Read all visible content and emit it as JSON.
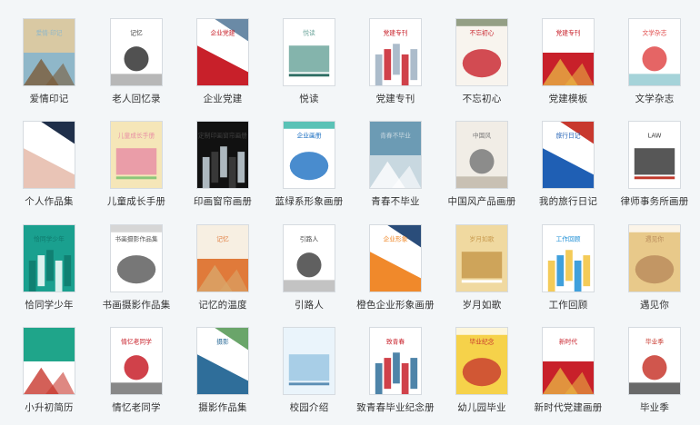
{
  "items": [
    {
      "label": "爱情印记",
      "cover_text": "爱情·印记",
      "colors": [
        "#d9c9a3",
        "#8fb7c9",
        "#7a5b3a"
      ],
      "icon": "couple-photo-icon"
    },
    {
      "label": "老人回忆录",
      "cover_text": "记忆",
      "colors": [
        "#ffffff",
        "#333333",
        "#999999"
      ],
      "icon": "ink-painting-icon"
    },
    {
      "label": "企业党建",
      "cover_text": "企业党建",
      "colors": [
        "#ffffff",
        "#c8202a",
        "#6a8aa6"
      ],
      "icon": "city-skyline-icon"
    },
    {
      "label": "悦读",
      "cover_text": "悦读",
      "colors": [
        "#ffffff",
        "#6fa79d",
        "#2f6e64"
      ],
      "icon": "chair-plant-icon"
    },
    {
      "label": "党建专刊",
      "cover_text": "党建专刊",
      "colors": [
        "#ffffff",
        "#c8202a",
        "#9db0c2"
      ],
      "icon": "flag-mountain-icon"
    },
    {
      "label": "不忘初心",
      "cover_text": "不忘初心",
      "colors": [
        "#f8f4ee",
        "#c8202a",
        "#7a8a6a"
      ],
      "icon": "landscape-icon"
    },
    {
      "label": "党建模板",
      "cover_text": "党建专刊",
      "colors": [
        "#ffffff",
        "#c8202a",
        "#e7b043"
      ],
      "icon": "tiananmen-icon"
    },
    {
      "label": "文学杂志",
      "cover_text": "文学杂志",
      "colors": [
        "#ffffff",
        "#e04a4a",
        "#7fc1c9"
      ],
      "icon": "red-leaves-icon"
    },
    {
      "label": "个人作品集",
      "cover_text": "",
      "colors": [
        "#ffffff",
        "#e9c4b6",
        "#1f2f4a"
      ],
      "icon": "triangle-portrait-icon"
    },
    {
      "label": "儿童成长手册",
      "cover_text": "儿童成长手册",
      "colors": [
        "#f5e6b8",
        "#e88fa4",
        "#8cc67a"
      ],
      "icon": "flowers-icon"
    },
    {
      "label": "印画窗帘画册",
      "cover_text": "定制印画窗帘画册",
      "colors": [
        "#111111",
        "#3f3f3f",
        "#c9d6de"
      ],
      "icon": "window-curtain-icon"
    },
    {
      "label": "蓝绿系形象画册",
      "cover_text": "企业画册",
      "colors": [
        "#ffffff",
        "#1b6fc2",
        "#2fb3a4"
      ],
      "icon": "blue-building-icon"
    },
    {
      "label": "青春不毕业",
      "cover_text": "青春不毕业",
      "colors": [
        "#6c9bb4",
        "#c8d8e0",
        "#ffffff"
      ],
      "icon": "graduation-icon"
    },
    {
      "label": "中国风产品画册",
      "cover_text": "中国风",
      "colors": [
        "#f1ede6",
        "#7a7a7a",
        "#b6ad9c"
      ],
      "icon": "round-window-icon"
    },
    {
      "label": "我的旅行日记",
      "cover_text": "旅行日记",
      "colors": [
        "#ffffff",
        "#1f5fb4",
        "#c8382e"
      ],
      "icon": "travel-photo-icon"
    },
    {
      "label": "律师事务所画册",
      "cover_text": "LAW",
      "colors": [
        "#ffffff",
        "#3a3a3a",
        "#c0392b"
      ],
      "icon": "law-sign-icon"
    },
    {
      "label": "恰同学少年",
      "cover_text": "恰同学少年",
      "colors": [
        "#1aa08f",
        "#ffffff",
        "#0f7a6d"
      ],
      "icon": "youth-title-icon"
    },
    {
      "label": "书画摄影作品集",
      "cover_text": "书画摄影作品集",
      "colors": [
        "#ffffff",
        "#555555",
        "#cccccc"
      ],
      "icon": "text-page-icon"
    },
    {
      "label": "记忆的温度",
      "cover_text": "记忆",
      "colors": [
        "#f7efe2",
        "#e07a3a",
        "#d9a66a"
      ],
      "icon": "autumn-leaves-icon"
    },
    {
      "label": "引路人",
      "cover_text": "引路人",
      "colors": [
        "#ffffff",
        "#444444",
        "#aaaaaa"
      ],
      "icon": "ink-mountain-icon"
    },
    {
      "label": "橙色企业形象画册",
      "cover_text": "企业形象",
      "colors": [
        "#ffffff",
        "#f0892b",
        "#2a4d7a"
      ],
      "icon": "orange-building-icon"
    },
    {
      "label": "岁月如歌",
      "cover_text": "岁月如歌",
      "colors": [
        "#f0d9a0",
        "#c89a4e",
        "#ffffff"
      ],
      "icon": "building-photo-icon"
    },
    {
      "label": "工作回顾",
      "cover_text": "工作回顾",
      "colors": [
        "#ffffff",
        "#1f8fd6",
        "#f2c23b"
      ],
      "icon": "staircase-icon"
    },
    {
      "label": "遇见你",
      "cover_text": "遇见你",
      "colors": [
        "#e8c98a",
        "#b88a5a",
        "#ffffff"
      ],
      "icon": "sunset-icon"
    },
    {
      "label": "小升初简历",
      "cover_text": "",
      "colors": [
        "#1fa58a",
        "#ffffff",
        "#c8382e"
      ],
      "icon": "student-photo-icon"
    },
    {
      "label": "情忆老同学",
      "cover_text": "情忆老同学",
      "colors": [
        "#ffffff",
        "#c8202a",
        "#555555"
      ],
      "icon": "ink-landscape-icon"
    },
    {
      "label": "摄影作品集",
      "cover_text": "摄影",
      "colors": [
        "#ffffff",
        "#2f6e9a",
        "#6aa56a"
      ],
      "icon": "bay-photo-icon"
    },
    {
      "label": "校园介绍",
      "cover_text": "",
      "colors": [
        "#eaf4fb",
        "#9cc7e3",
        "#5c8fb5"
      ],
      "icon": "campus-icon"
    },
    {
      "label": "致青春毕业纪念册",
      "cover_text": "致青春",
      "colors": [
        "#ffffff",
        "#c8202a",
        "#2f6e9a"
      ],
      "icon": "group-photo-icon"
    },
    {
      "label": "幼儿园毕业",
      "cover_text": "毕业纪念",
      "colors": [
        "#f6d24a",
        "#c8382e",
        "#ffffff"
      ],
      "icon": "kids-graduation-icon"
    },
    {
      "label": "新时代党建画册",
      "cover_text": "新时代",
      "colors": [
        "#ffffff",
        "#c8202a",
        "#e7b043"
      ],
      "icon": "red-ribbon-icon"
    },
    {
      "label": "毕业季",
      "cover_text": "毕业季",
      "colors": [
        "#ffffff",
        "#c8382e",
        "#2a2a2a"
      ],
      "icon": "graduation-cap-icon"
    }
  ]
}
